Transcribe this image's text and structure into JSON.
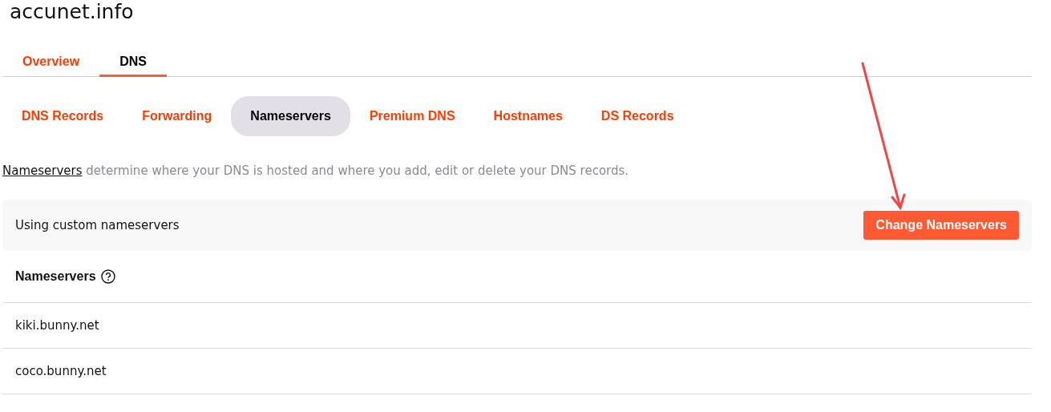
{
  "domain": "accunet.info",
  "tabs": [
    {
      "label": "Overview",
      "selected": false
    },
    {
      "label": "DNS",
      "selected": true
    }
  ],
  "subtabs": [
    {
      "label": "DNS Records",
      "selected": false
    },
    {
      "label": "Forwarding",
      "selected": false
    },
    {
      "label": "Nameservers",
      "selected": true
    },
    {
      "label": "Premium DNS",
      "selected": false
    },
    {
      "label": "Hostnames",
      "selected": false
    },
    {
      "label": "DS Records",
      "selected": false
    }
  ],
  "description": {
    "link": "Nameservers",
    "text": " determine where your DNS is hosted and where you add, edit or delete your DNS records."
  },
  "status_panel": {
    "text": "Using custom nameservers",
    "button": "Change Nameservers"
  },
  "nameservers": {
    "heading": "Nameservers",
    "rows": [
      "kiki.bunny.net",
      "coco.bunny.net"
    ]
  }
}
